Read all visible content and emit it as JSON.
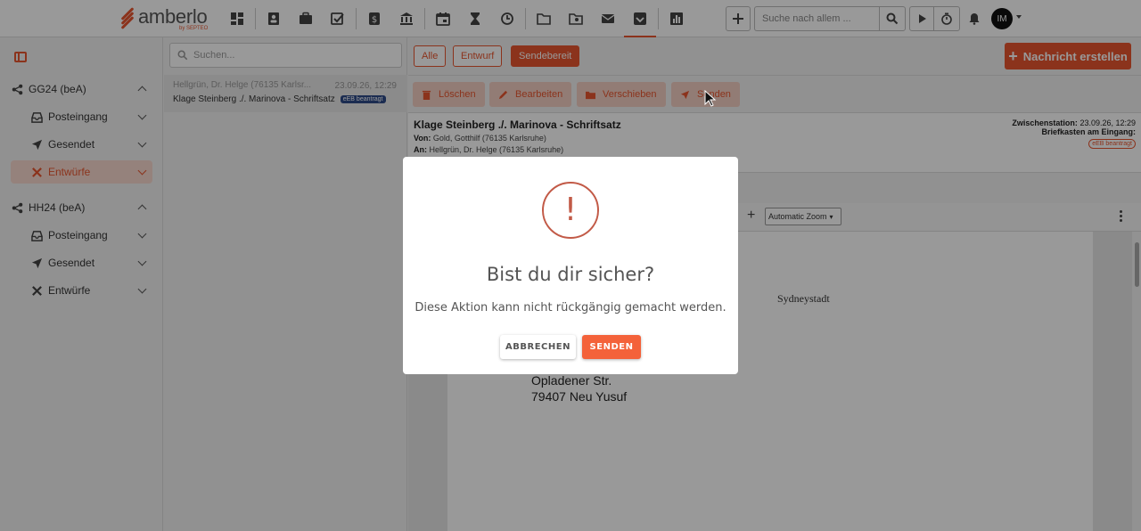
{
  "brand": {
    "name": "amberlo",
    "sub": "by SEPTEO",
    "accent": "#e8562f"
  },
  "topbar": {
    "nav_icons": [
      "dashboard-icon",
      "contacts-icon",
      "briefcase-icon",
      "tasks-icon",
      "billing-icon",
      "bank-icon",
      "calendar-icon",
      "hourglass-icon",
      "time-history-icon",
      "folder-icon",
      "folder-search-icon",
      "mail-icon",
      "bea-inbox-icon",
      "reports-icon"
    ],
    "search_placeholder": "Suche nach allem ...",
    "avatar_initials": "IM"
  },
  "sidebar": {
    "groups": [
      {
        "label": "GG24 (beA)",
        "items": [
          {
            "label": "Posteingang"
          },
          {
            "label": "Gesendet"
          },
          {
            "label": "Entwürfe"
          }
        ]
      },
      {
        "label": "HH24 (beA)",
        "items": [
          {
            "label": "Posteingang"
          },
          {
            "label": "Gesendet"
          },
          {
            "label": "Entwürfe"
          }
        ]
      }
    ]
  },
  "list": {
    "search_placeholder": "Suchen...",
    "items": [
      {
        "from": "Hellgrün, Dr. Helge (76135 Karlsr...",
        "date": "23.09.26, 12:29",
        "subject": "Klage Steinberg ./. Marinova - Schriftsatz",
        "badge": "eEB beantragt"
      }
    ]
  },
  "filters": {
    "all": "Alle",
    "draft": "Entwurf",
    "ready": "Sendebereit"
  },
  "create_button": "Nachricht erstellen",
  "actions": {
    "delete": "Löschen",
    "edit": "Bearbeiten",
    "move": "Verschieben",
    "send": "Senden"
  },
  "message": {
    "title": "Klage Steinberg ./. Marinova - Schriftsatz",
    "from_label": "Von:",
    "from": "Gold, Gotthilf (76135 Karlsruhe)",
    "to_label": "An:",
    "to": "Hellgrün, Dr. Helge (76135 Karlsruhe)",
    "station_label": "Zwischenstation:",
    "station": "23.09.26, 12:29",
    "mailbox_label": "Briefkasten am Eingang:",
    "badge": "eEB beantragt"
  },
  "pdf": {
    "zoom": "Automatic Zoom",
    "text_city": "Sydneystadt",
    "address_line1": "Opladener Str.",
    "address_line2": "79407 Neu Yusuf"
  },
  "modal": {
    "icon": "!",
    "title": "Bist du dir sicher?",
    "text": "Diese Aktion kann nicht rückgängig gemacht werden.",
    "cancel": "ABBRECHEN",
    "confirm": "SENDEN"
  }
}
